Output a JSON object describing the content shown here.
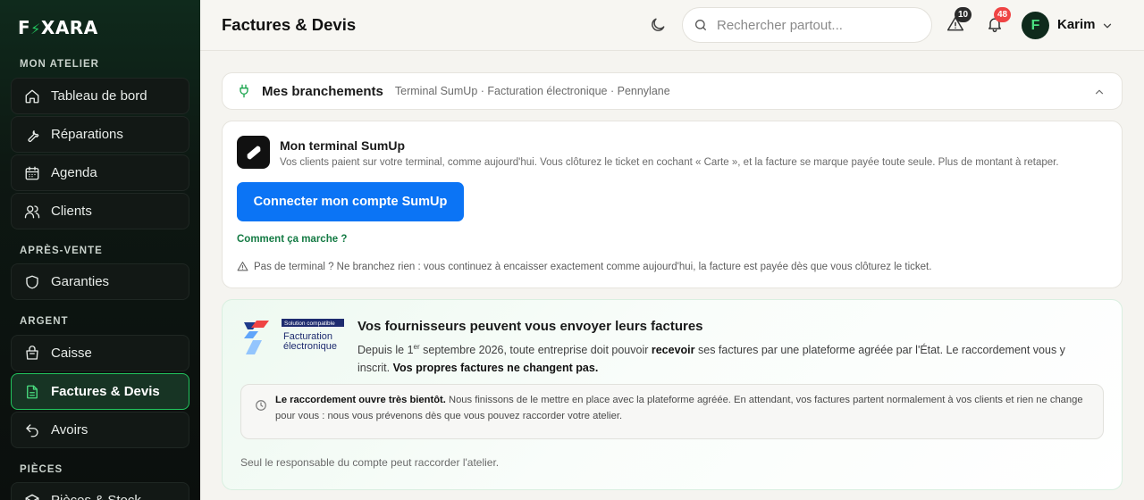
{
  "app": {
    "brand_left": "F",
    "brand_right": "XARA"
  },
  "sidebar": {
    "sections": [
      {
        "label": "MON ATELIER"
      },
      {
        "label": "APRÈS-VENTE"
      },
      {
        "label": "ARGENT"
      },
      {
        "label": "PIÈCES"
      }
    ],
    "items": [
      {
        "label": "Tableau de bord",
        "icon": "home-icon"
      },
      {
        "label": "Réparations",
        "icon": "wrench-icon"
      },
      {
        "label": "Agenda",
        "icon": "calendar-icon"
      },
      {
        "label": "Clients",
        "icon": "users-icon"
      },
      {
        "label": "Garanties",
        "icon": "shield-icon"
      },
      {
        "label": "Caisse",
        "icon": "cash-register-icon"
      },
      {
        "label": "Factures & Devis",
        "icon": "document-icon",
        "active": true
      },
      {
        "label": "Avoirs",
        "icon": "undo-icon"
      },
      {
        "label": "Pièces & Stock",
        "icon": "box-icon"
      }
    ]
  },
  "header": {
    "title": "Factures & Devis",
    "search_placeholder": "Rechercher partout...",
    "alerts_count": "10",
    "notifications_count": "48",
    "user_initial": "F",
    "user_name": "Karim"
  },
  "connections": {
    "title": "Mes branchements",
    "subtitle": "Terminal SumUp · Facturation électronique · Pennylane"
  },
  "sumup": {
    "title": "Mon terminal SumUp",
    "description": "Vos clients paient sur votre terminal, comme aujourd'hui. Vous clôturez le ticket en cochant « Carte », et la facture se marque payée toute seule. Plus de montant à retaper.",
    "connect_button": "Connecter mon compte SumUp",
    "how_link": "Comment ça marche ?",
    "note": "Pas de terminal ? Ne branchez rien : vous continuez à encaisser exactement comme aujourd'hui, la facture est payée dès que vous clôturez le ticket."
  },
  "einvoicing": {
    "logo_badge": "Solution compatible",
    "logo_line1": "Facturation",
    "logo_line2": "électronique",
    "title": "Vos fournisseurs peuvent vous envoyer leurs factures",
    "text_1": "Depuis le 1",
    "text_sup": "er",
    "text_2": " septembre 2026, toute entreprise doit pouvoir ",
    "text_bold_1": "recevoir",
    "text_3": " ses factures par une plateforme agréée par l'État. Le raccordement vous y inscrit. ",
    "text_bold_2": "Vos propres factures ne changent pas.",
    "info_bold": "Le raccordement ouvre très bientôt.",
    "info_text": " Nous finissons de le mettre en place avec la plateforme agréée. En attendant, vos factures partent normalement à vos clients et rien ne change pour vous : nous vous prévenons dès que vous pouvez raccorder votre atelier.",
    "footer": "Seul le responsable du compte peut raccorder l'atelier."
  },
  "colors": {
    "accent": "#22c55e",
    "primary_button": "#0b74f5",
    "link": "#137a43",
    "badge_red": "#ef4444"
  }
}
